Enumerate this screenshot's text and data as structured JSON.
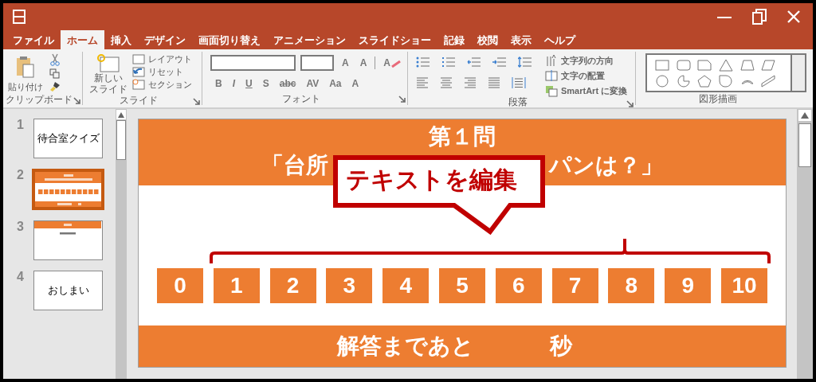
{
  "tabs": [
    {
      "label": "ファイル",
      "selected": false
    },
    {
      "label": "ホーム",
      "selected": true
    },
    {
      "label": "挿入",
      "selected": false
    },
    {
      "label": "デザイン",
      "selected": false
    },
    {
      "label": "画面切り替え",
      "selected": false
    },
    {
      "label": "アニメーション",
      "selected": false
    },
    {
      "label": "スライドショー",
      "selected": false
    },
    {
      "label": "記録",
      "selected": false
    },
    {
      "label": "校閲",
      "selected": false
    },
    {
      "label": "表示",
      "selected": false
    },
    {
      "label": "ヘルプ",
      "selected": false
    }
  ],
  "ribbon": {
    "clipboard": {
      "paste": "貼り付け",
      "group": "クリップボード"
    },
    "slides": {
      "new_slide": [
        "新しい",
        "スライド"
      ],
      "commands": [
        "レイアウト",
        "リセット",
        "セクション"
      ],
      "group": "スライド"
    },
    "font": {
      "size_buttons": [
        "A",
        "A"
      ],
      "clear": "A",
      "styles": [
        "B",
        "I",
        "U",
        "S",
        "abc",
        "AV",
        "Aa",
        "A"
      ],
      "group": "フォント"
    },
    "paragraph": {
      "commands": [
        "文字列の方向",
        "文字の配置",
        "SmartArt に変換"
      ],
      "group": "段落"
    },
    "drawing": {
      "group": "図形描画"
    }
  },
  "slides_panel": [
    {
      "number": "1",
      "kind": "title",
      "text": "待合室クイズ",
      "selected": false
    },
    {
      "number": "2",
      "kind": "question",
      "selected": true
    },
    {
      "number": "3",
      "kind": "answer",
      "selected": false
    },
    {
      "number": "4",
      "kind": "title",
      "text": "おしまい",
      "selected": false
    }
  ],
  "slide": {
    "heading": "第１問",
    "question_start": "「台所",
    "question_end": "パンは？」",
    "choices": [
      "0",
      "1",
      "2",
      "3",
      "4",
      "5",
      "6",
      "7",
      "8",
      "9",
      "10"
    ],
    "footer_left": "解答まであと",
    "footer_right": "秒"
  },
  "callout": {
    "text": "テキストを編集"
  }
}
